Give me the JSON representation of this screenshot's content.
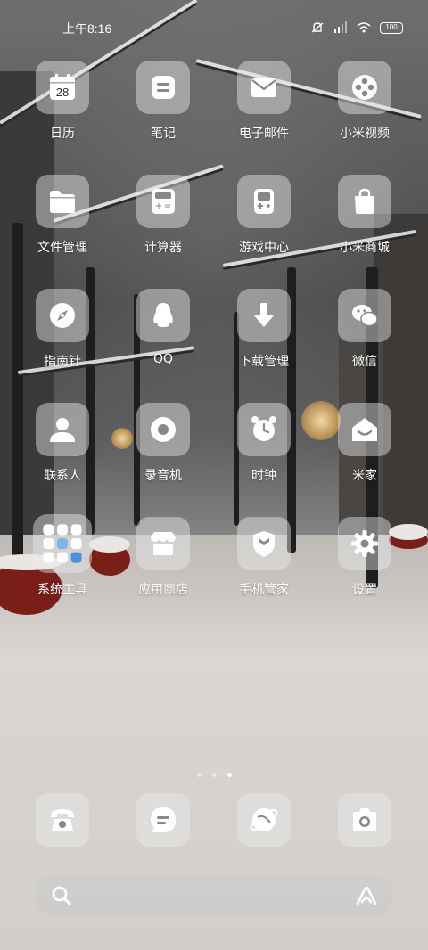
{
  "status_bar": {
    "time": "上午8:16",
    "battery": "100"
  },
  "apps": [
    {
      "label": "日历",
      "icon": "calendar-icon",
      "badge": "28"
    },
    {
      "label": "笔记",
      "icon": "notes-icon"
    },
    {
      "label": "电子邮件",
      "icon": "mail-icon"
    },
    {
      "label": "小米视频",
      "icon": "video-icon"
    },
    {
      "label": "文件管理",
      "icon": "folder-icon"
    },
    {
      "label": "计算器",
      "icon": "calculator-icon"
    },
    {
      "label": "游戏中心",
      "icon": "gamepad-icon"
    },
    {
      "label": "小米商城",
      "icon": "shopping-bag-icon"
    },
    {
      "label": "指南针",
      "icon": "compass-icon"
    },
    {
      "label": "QQ",
      "icon": "qq-icon"
    },
    {
      "label": "下载管理",
      "icon": "download-icon"
    },
    {
      "label": "微信",
      "icon": "wechat-icon"
    },
    {
      "label": "联系人",
      "icon": "contact-icon"
    },
    {
      "label": "录音机",
      "icon": "recorder-icon"
    },
    {
      "label": "时钟",
      "icon": "alarm-clock-icon"
    },
    {
      "label": "米家",
      "icon": "mijia-home-icon"
    },
    {
      "label": "系统工具",
      "icon": "folder-grid-icon"
    },
    {
      "label": "应用商店",
      "icon": "store-icon"
    },
    {
      "label": "手机管家",
      "icon": "security-shield-icon"
    },
    {
      "label": "设置",
      "icon": "gear-icon"
    }
  ],
  "page_indicator": {
    "count": 3,
    "active": 3
  },
  "dock": [
    {
      "icon": "phone-icon"
    },
    {
      "icon": "message-icon"
    },
    {
      "icon": "browser-icon"
    },
    {
      "icon": "camera-icon"
    }
  ],
  "search_bar": {
    "left_icon": "search-icon",
    "right_icon": "assistant-icon"
  }
}
